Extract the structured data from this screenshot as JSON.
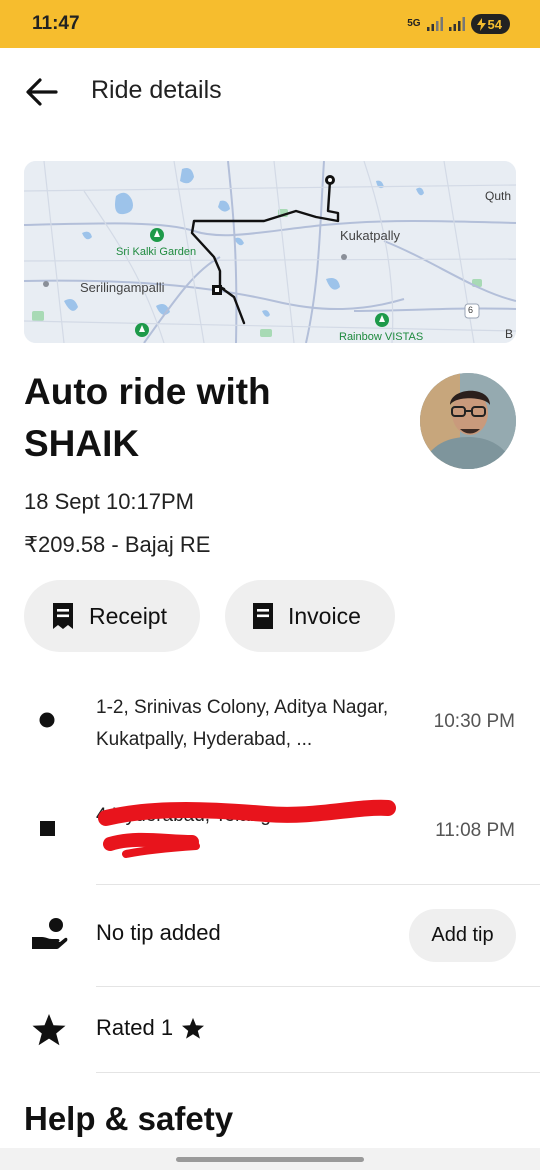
{
  "status_bar": {
    "time": "11:47",
    "network": "5G",
    "battery": "54"
  },
  "header": {
    "title": "Ride details"
  },
  "map": {
    "labels": {
      "sri_kalki_garden": "Sri Kalki Garden",
      "serilingampalli": "Serilingampalli",
      "kukatpally": "Kukatpally",
      "quth": "Quth",
      "rainbow_vistas": "Rainbow VISTAS",
      "road_number": "6",
      "edge_letter": "B"
    }
  },
  "ride": {
    "heading": "Auto ride with SHAIK",
    "date": "18 Sept 10:17PM",
    "fare": "₹209.58 - Bajaj RE"
  },
  "actions": {
    "receipt_label": "Receipt",
    "invoice_label": "Invoice"
  },
  "trip": {
    "pickup": {
      "address": "1-2, Srinivas Colony, Aditya Nagar, Kukatpally, Hyderabad, ...",
      "time": "10:30 PM"
    },
    "dropoff": {
      "address": "4 Hyderabad, Telanga...",
      "time": "11:08 PM"
    }
  },
  "tip": {
    "status": "No tip added",
    "button_label": "Add tip"
  },
  "rating": {
    "label": "Rated 1"
  },
  "help": {
    "heading": "Help & safety"
  },
  "colors": {
    "accent_yellow": "#f6bd2e",
    "pill_bg": "#efefef",
    "redaction": "#e8141c",
    "map_water": "#9dc3ea",
    "map_park": "#a8dab5"
  },
  "icons": {
    "back": "arrow-left-icon",
    "receipt": "receipt-icon",
    "invoice": "invoice-icon",
    "tip": "hand-coin-icon",
    "rating": "star-icon"
  }
}
